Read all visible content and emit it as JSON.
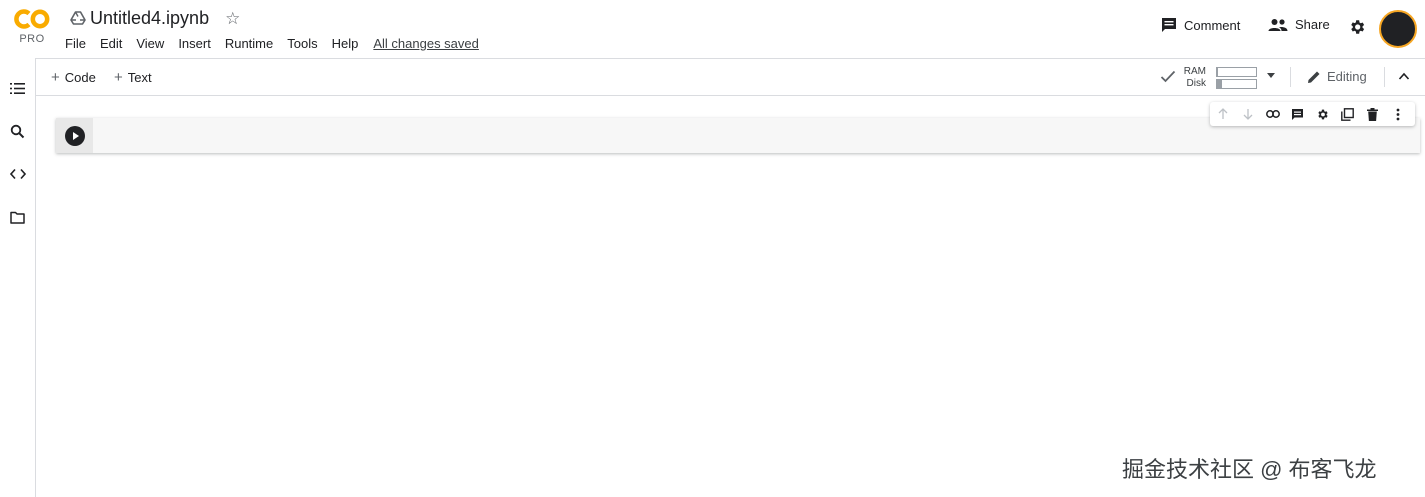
{
  "logo": {
    "badge": "PRO",
    "accent_color": "#f9ab00"
  },
  "notebook": {
    "title": "Untitled4.ipynb",
    "icon": "google-drive-icon"
  },
  "menu": [
    "File",
    "Edit",
    "View",
    "Insert",
    "Runtime",
    "Tools",
    "Help"
  ],
  "save_status": "All changes saved",
  "header_actions": {
    "comment": "Comment",
    "share": "Share",
    "settings_icon": "gear-icon",
    "avatar_icon": "avatar"
  },
  "rail": [
    "table-of-contents-icon",
    "search-icon",
    "code-snippets-icon",
    "files-icon"
  ],
  "toolbar": {
    "add_code": "Code",
    "add_text": "Text",
    "editing": "Editing"
  },
  "resources": {
    "ram_label": "RAM",
    "disk_label": "Disk",
    "ram_usage": 0.02,
    "disk_usage": 0.12,
    "status_icon": "check-icon"
  },
  "cell_toolbar": [
    "arrow-up-icon",
    "arrow-down-icon",
    "link-icon",
    "comment-icon",
    "gear-icon",
    "mirror-cell-icon",
    "trash-icon",
    "more-vert-icon"
  ],
  "watermark": "掘金技术社区 @ 布客飞龙"
}
